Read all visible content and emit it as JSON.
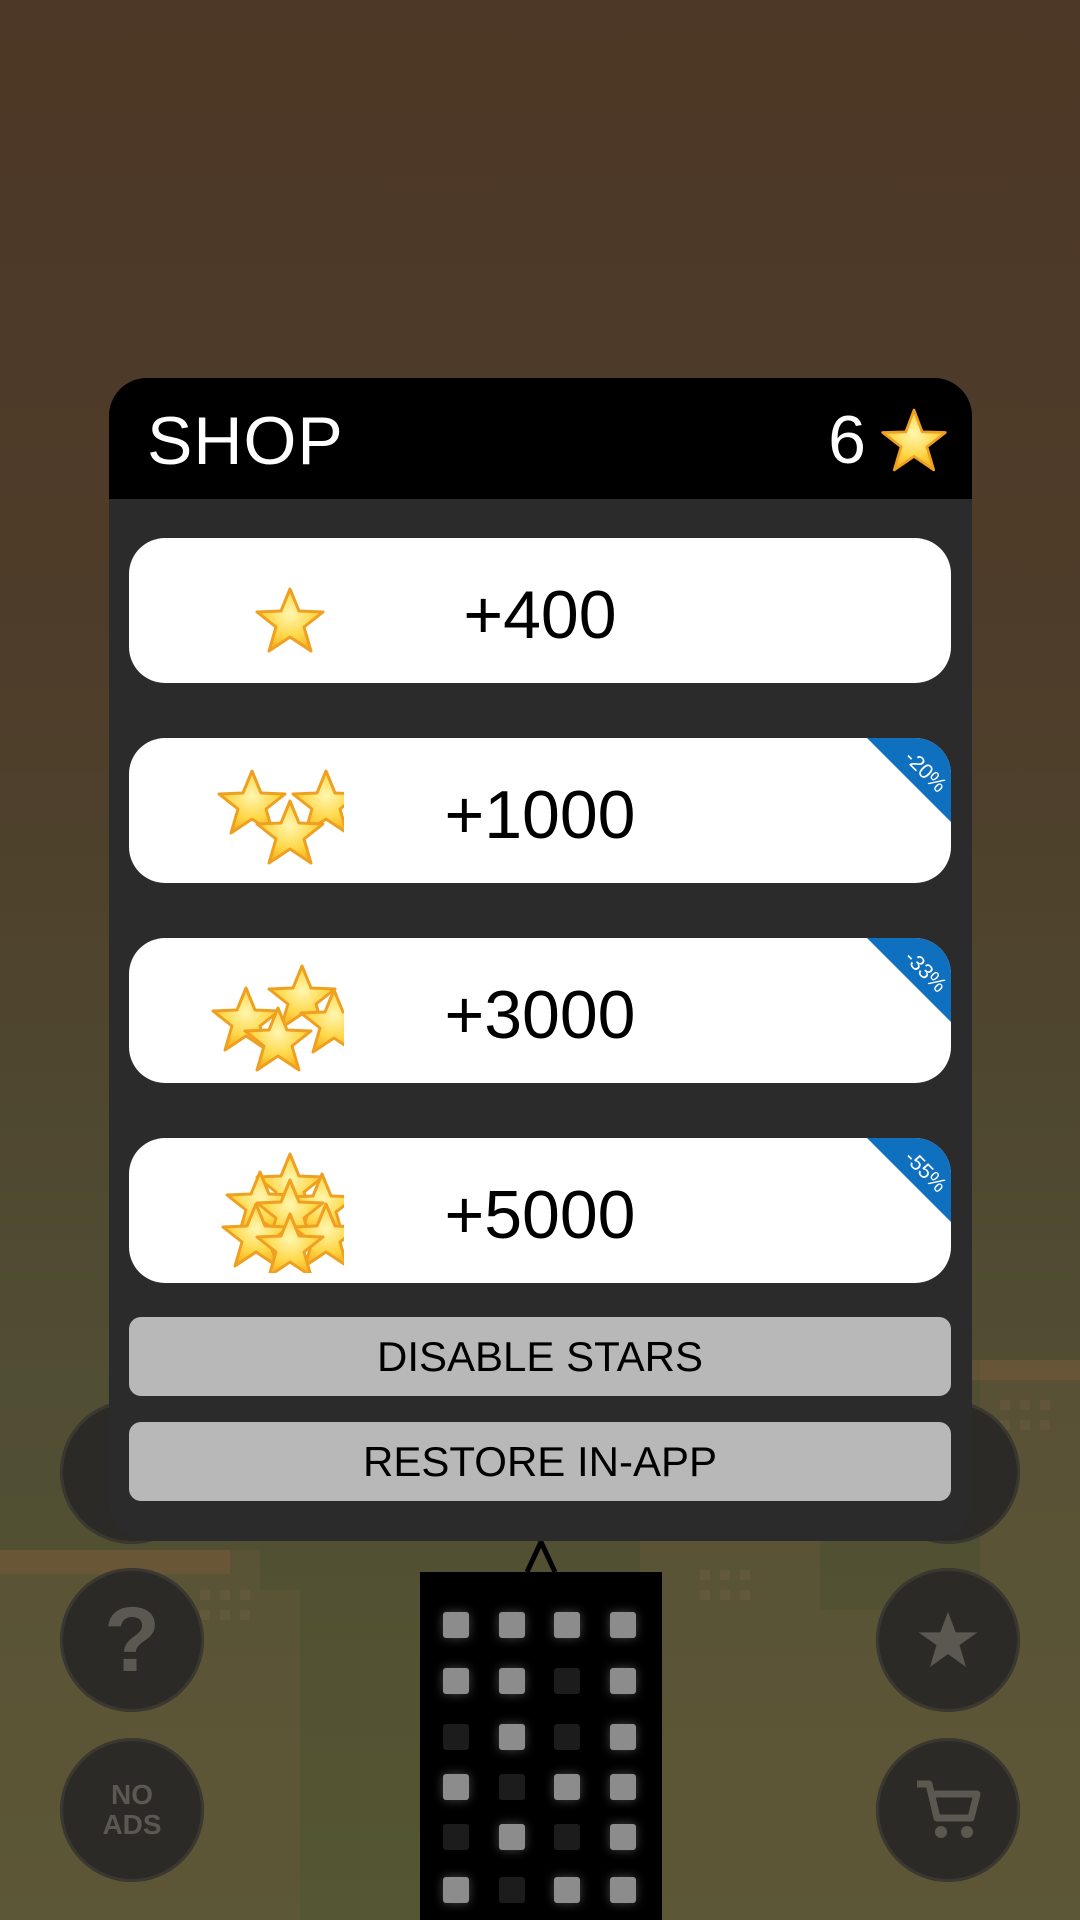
{
  "shop": {
    "title": "SHOP",
    "balance": "6",
    "balance_icon": "star-icon",
    "packs": [
      {
        "amount": "+400",
        "stars": 1,
        "discount": ""
      },
      {
        "amount": "+1000",
        "stars": 3,
        "discount": "-20%"
      },
      {
        "amount": "+3000",
        "stars": 4,
        "discount": "-33%"
      },
      {
        "amount": "+5000",
        "stars": 7,
        "discount": "-55%"
      }
    ],
    "disable_stars_label": "DISABLE STARS",
    "restore_label": "RESTORE IN-APP"
  },
  "background": {
    "help_label": "?",
    "no_ads_label": "NO ADS",
    "icons": [
      "help-icon",
      "no-ads-icon",
      "star-icon",
      "cart-icon"
    ]
  },
  "colors": {
    "panel": "#2b2b2b",
    "header": "#000000",
    "discount_ribbon": "#1070c0",
    "gray_button": "#b8b8b8",
    "star_fill": "#ffd84a",
    "star_outline": "#f0a020"
  }
}
